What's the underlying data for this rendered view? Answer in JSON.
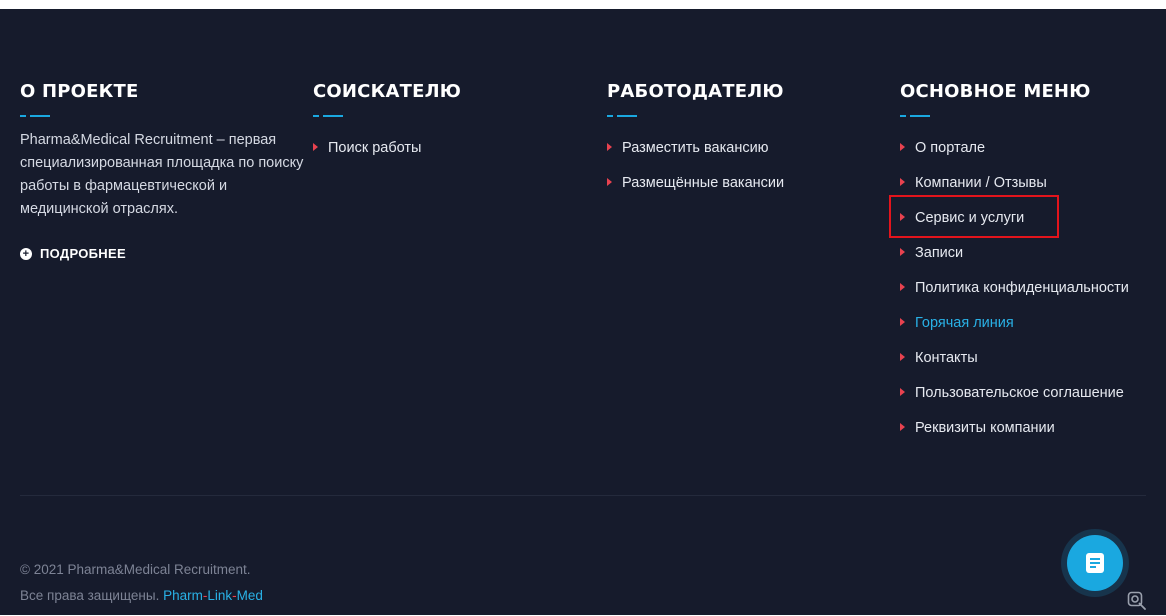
{
  "columns": {
    "about": {
      "title": "О ПРОЕКТЕ",
      "text": "Pharma&Medical Recruitment – первая специализированная площадка по поиску работы в фармацевтической и медицинской отраслях.",
      "more_label": "ПОДРОБНЕЕ"
    },
    "seeker": {
      "title": "СОИСКАТЕЛЮ",
      "items": [
        {
          "label": "Поиск работы"
        }
      ]
    },
    "employer": {
      "title": "РАБОТОДАТЕЛЮ",
      "items": [
        {
          "label": "Разместить вакансию"
        },
        {
          "label": "Размещённые вакансии"
        }
      ]
    },
    "main_menu": {
      "title": "ОСНОВНОЕ МЕНЮ",
      "items": [
        {
          "label": "О портале"
        },
        {
          "label": "Компании / Отзывы"
        },
        {
          "label": "Сервис и услуги"
        },
        {
          "label": "Записи"
        },
        {
          "label": "Политика конфиденциальности"
        },
        {
          "label": "Горячая линия"
        },
        {
          "label": "Контакты"
        },
        {
          "label": "Пользовательское соглашение"
        },
        {
          "label": "Реквизиты компании"
        }
      ]
    }
  },
  "footer": {
    "copyright_line1": "© 2021 Pharma&Medical Recruitment.",
    "copyright_line2": "Все права защищены.",
    "brand_parts": [
      "Pharm",
      "-",
      "Link",
      "-",
      "Med"
    ]
  },
  "widgets": {
    "chat_icon": "chat-icon",
    "search_icon": "search-icon"
  },
  "colors": {
    "background": "#161b2c",
    "accent": "#1aa8e0",
    "bullet": "#e8424f",
    "highlight": "#e3141c"
  }
}
